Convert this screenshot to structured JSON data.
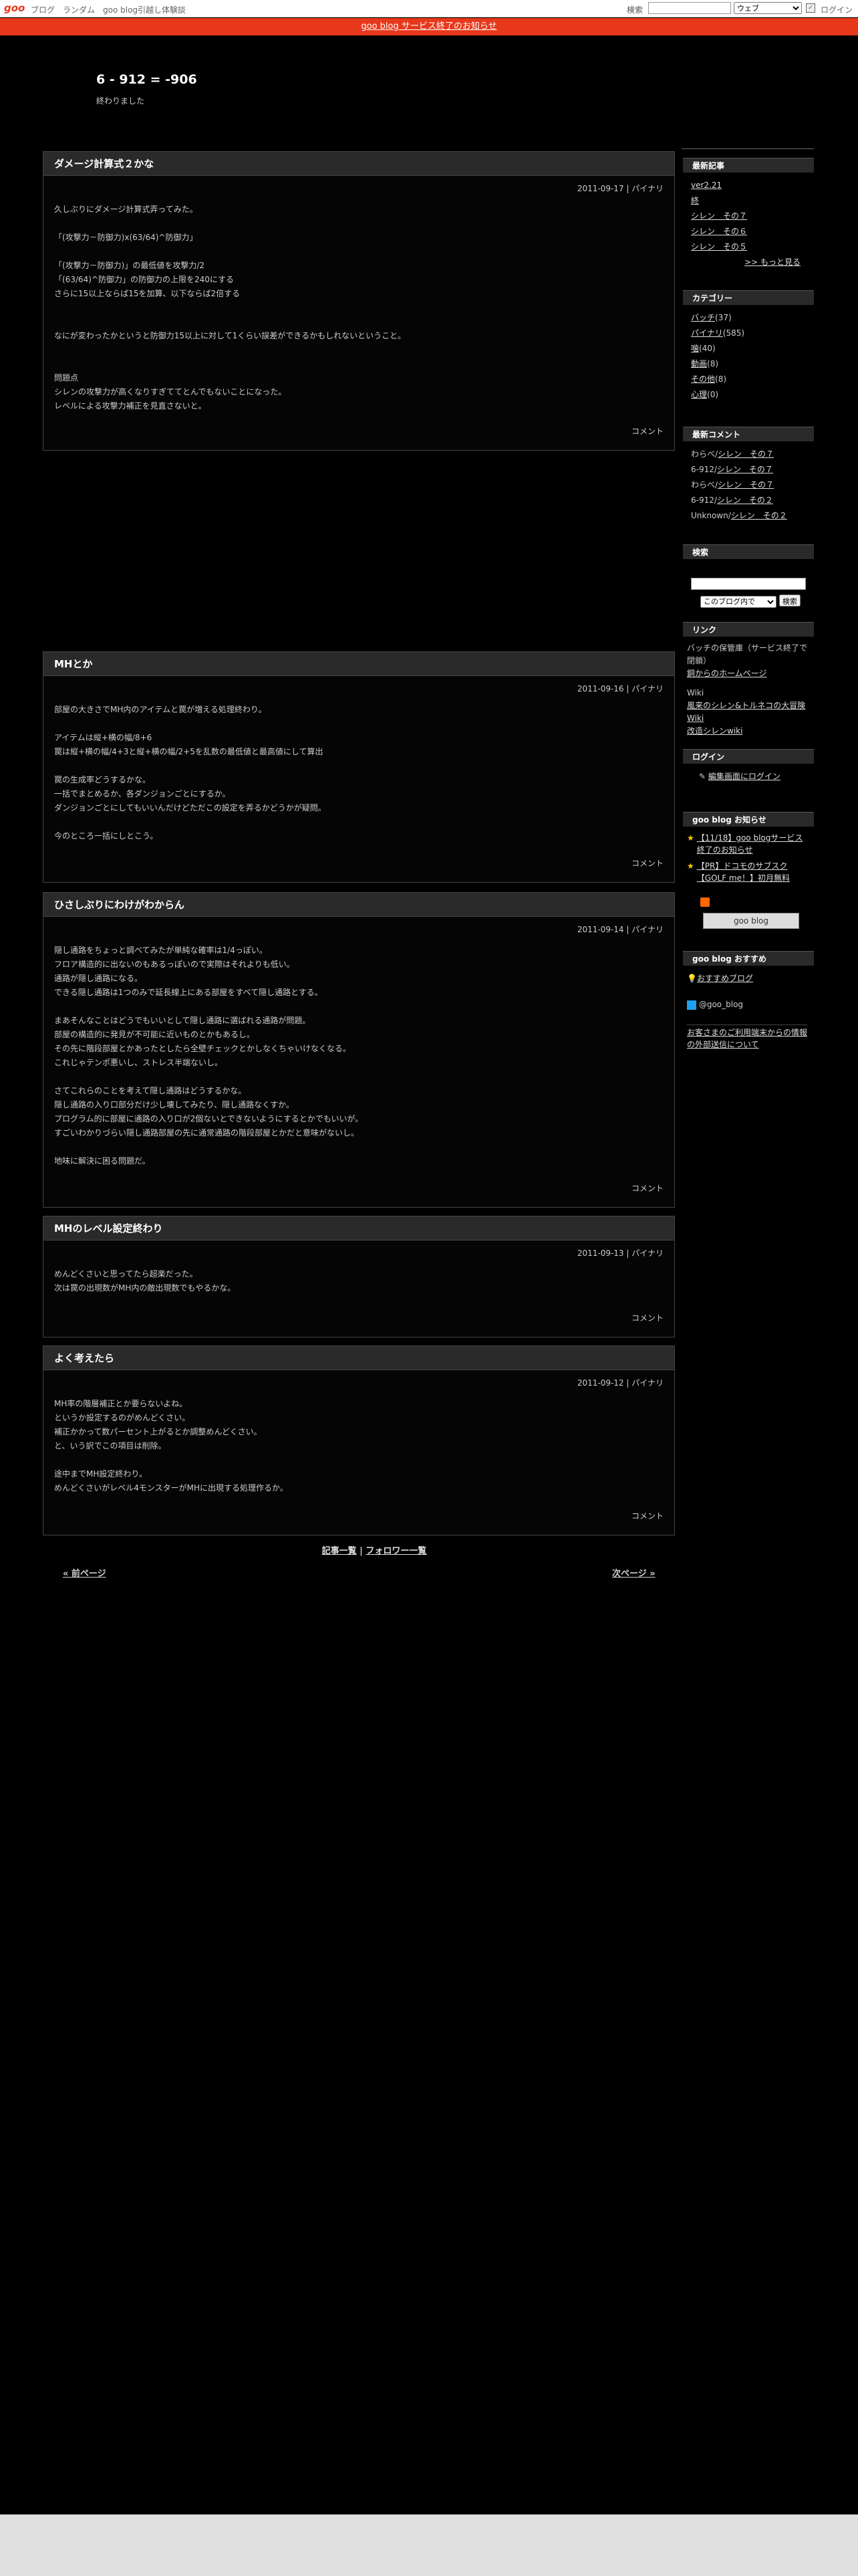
{
  "toolbar": {
    "logo": "goo",
    "links": [
      "ブログ",
      "ランダム",
      "goo blog引越し体験談"
    ],
    "search_label": "検索",
    "search_select": "ウェブ",
    "login": "ログイン"
  },
  "notice": "goo blog サービス終了のお知らせ",
  "site": {
    "title": "6 - 912 = -906",
    "description": "終わりました"
  },
  "entries": [
    {
      "title": "ダメージ計算式２かな",
      "date": "2011-09-17 | パイナリ",
      "body": "久しぶりにダメージ計算式弄ってみた。\n\n「(攻撃力－防御力)x(63/64)^防御力」\n\n「(攻撃力－防御力)」の最低値を攻撃力/2\n「(63/64)^防御力」の防御力の上限を240にする\nさらに15以上ならば15を加算、以下ならば2倍する\n\n\nなにが変わったかというと防御力15以上に対して1くらい誤差ができるかもしれないということ。\n\n\n問題点\nシレンの攻撃力が高くなりすぎててとんでもないことになった。\nレベルによる攻撃力補正を見直さないと。",
      "comment": "コメント"
    },
    {
      "title": "MHとか",
      "date": "2011-09-16 | パイナリ",
      "body": "部屋の大きさでMH内のアイテムと罠が増える処理終わり。\n\nアイテムは縦+横の幅/8+6\n罠は縦+横の幅/4+3と縦+横の幅/2+5を乱数の最低値と最高値にして算出\n\n罠の生成率どうするかな。\n一括でまとめるか、各ダンジョンごとにするか。\nダンジョンごとにしてもいいんだけどただこの設定を弄るかどうかが疑問。\n\n今のところ一括にしとこう。",
      "comment": "コメント"
    },
    {
      "title": "ひさしぶりにわけがわからん",
      "date": "2011-09-14 | パイナリ",
      "body": "隠し通路をちょっと調べてみたが単純な確率は1/4っぽい。\nフロア構造的に出ないのもあるっぽいので実際はそれよりも低い。\n通路が隠し通路になる。\nできる隠し通路は1つのみで延長線上にある部屋をすべて隠し通路とする。\n\nまあそんなことはどうでもいいとして隠し通路に選ばれる通路が問題。\n部屋の構造的に発見が不可能に近いものとかもあるし。\nその先に階段部屋とかあったとしたら全壁チェックとかしなくちゃいけなくなる。\nこれじゃテンポ悪いし、ストレス半端ないし。\n\nさてこれらのことを考えて隠し通路はどうするかな。\n隠し通路の入り口部分だけ少し壊してみたり、隠し通路なくすか。\nプログラム的に部屋に通路の入り口が2個ないとできないようにするとかでもいいが。\nすごいわかりづらい隠し通路部屋の先に通常通路の階段部屋とかだと意味がないし。\n\n地味に解決に困る問題だ。",
      "comment": "コメント"
    },
    {
      "title": "MHのレベル設定終わり",
      "date": "2011-09-13 | パイナリ",
      "body": "めんどくさいと思ってたら超楽だった。\n次は罠の出現数がMH内の敵出現数でもやるかな。",
      "comment": "コメント"
    },
    {
      "title": "よく考えたら",
      "date": "2011-09-12 | パイナリ",
      "body": "MH率の階層補正とか要らないよね。\nというか設定するのがめんどくさい。\n補正かかって数パーセント上がるとか調整めんどくさい。\nと、いう訳でこの項目は削除。\n\n途中までMH設定終わり。\nめんどくさいがレベル4モンスターがMHに出現する処理作るか。",
      "comment": "コメント"
    }
  ],
  "pager": {
    "list": "記事一覧",
    "sep": "|",
    "follow": "フォロワー一覧",
    "prev": "« 前ページ",
    "next": "次ページ »"
  },
  "sidebar": {
    "recent_title": "最新記事",
    "recent": [
      "ver2.21",
      "終",
      "シレン　その７",
      "シレン　その６",
      "シレン　その５"
    ],
    "more": ">> もっと見る",
    "cat_title": "カテゴリー",
    "categories": [
      {
        "name": "バッチ",
        "count": "(37)"
      },
      {
        "name": "パイナリ",
        "count": "(585)"
      },
      {
        "name": "噛",
        "count": "(40)"
      },
      {
        "name": "動画",
        "count": "(8)"
      },
      {
        "name": "その他",
        "count": "(8)"
      },
      {
        "name": "心理",
        "count": "(0)"
      }
    ],
    "comment_title": "最新コメント",
    "comments": [
      {
        "who": "わらべ/",
        "post": "シレン　その７"
      },
      {
        "who": "6-912/",
        "post": "シレン　その７"
      },
      {
        "who": "わらべ/",
        "post": "シレン　その７"
      },
      {
        "who": "6-912/",
        "post": "シレン　その２"
      },
      {
        "who": "Unknown/",
        "post": "シレン　その２"
      }
    ],
    "search_title": "検索",
    "search_scope": "このブログ内で",
    "search_btn": "検索",
    "link_title": "リンク",
    "links_a": [
      "バッチの保管庫（サービス終了で閉鎖）"
    ],
    "link_a_url": "銅からのホームページ",
    "wiki_label": "Wiki",
    "links_b": [
      "風来のシレン&トルネコの大冒険 Wiki",
      "改造シレンwiki"
    ],
    "login_title": "ログイン",
    "login_link": "編集画面にログイン",
    "goo_title": "goo blog お知らせ",
    "goo_news": [
      "【11/18】goo blogサービス終了のお知らせ",
      "【PR】ドコモのサブスク【GOLF me！】初月無料"
    ],
    "goo_btn": "goo blog",
    "rec_title": "goo blog おすすめ",
    "rec_link": "おすすめブログ",
    "twitter": "@goo_blog",
    "info_link": "お客さまのご利用端末からの情報の外部送信について"
  }
}
